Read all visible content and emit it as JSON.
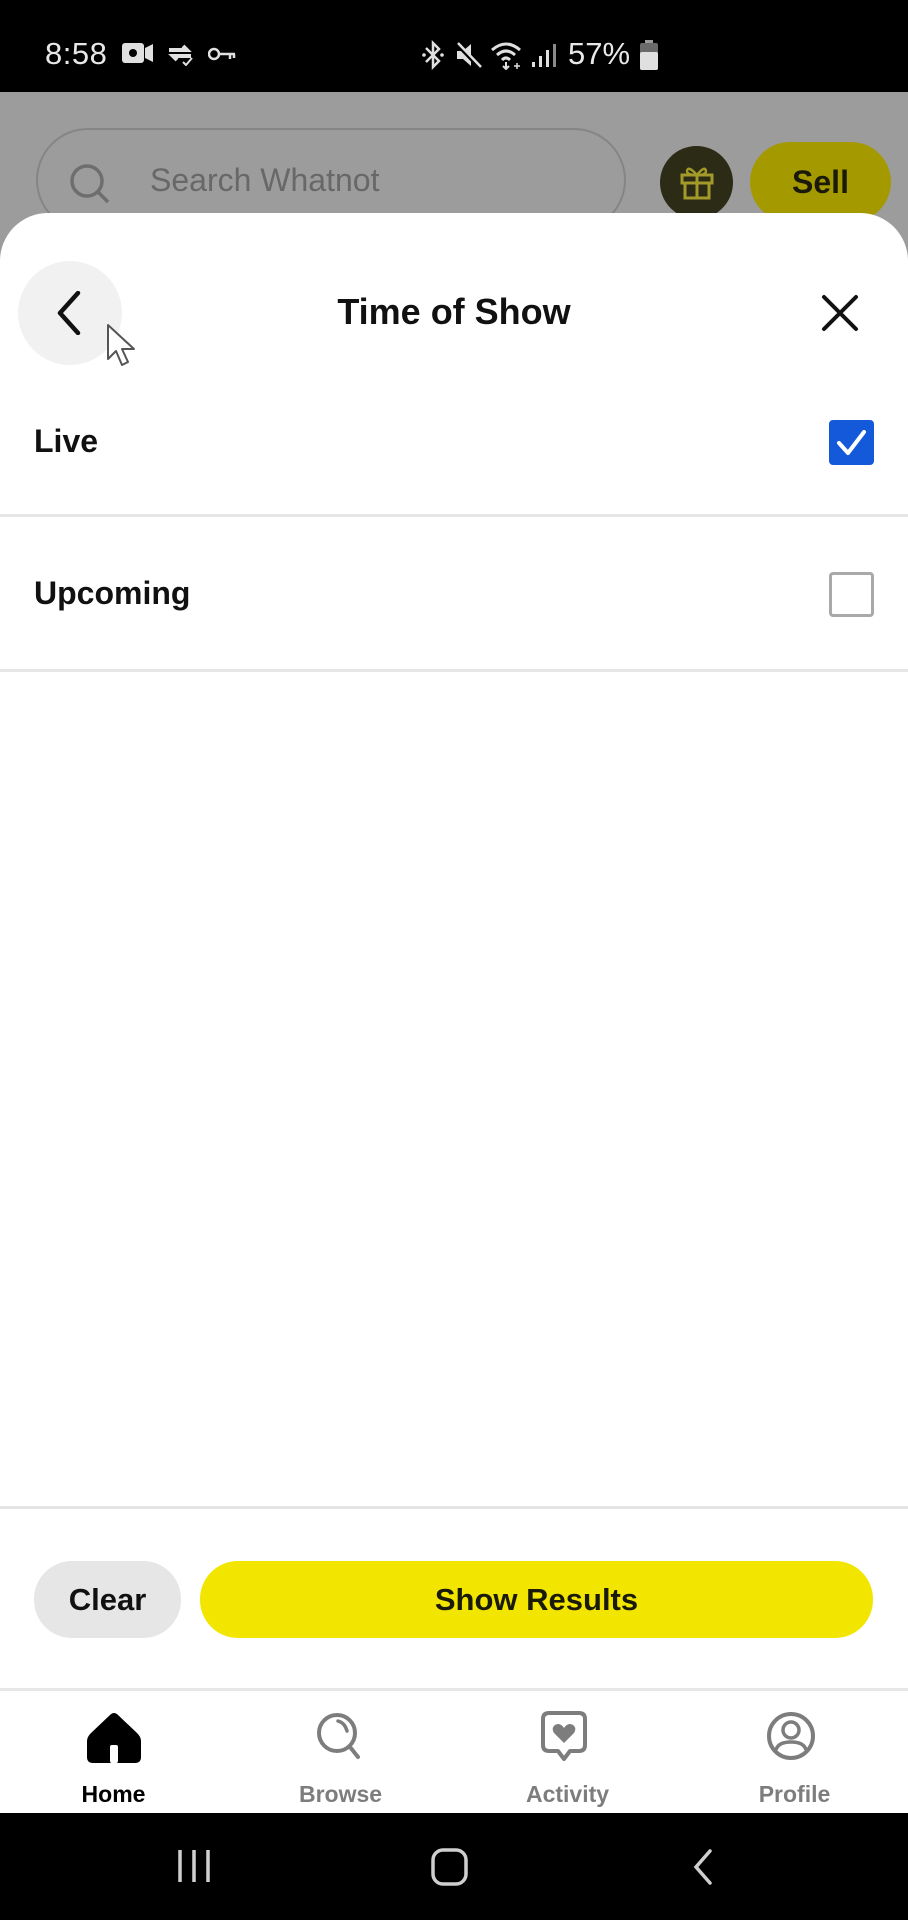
{
  "status_bar": {
    "time": "8:58",
    "battery_percent": "57%",
    "icons": [
      "video-record-icon",
      "vpn-sync-icon",
      "key-icon",
      "bluetooth-icon",
      "mute-icon",
      "wifi-icon",
      "signal-icon",
      "battery-icon"
    ]
  },
  "background_app": {
    "search_placeholder": "Search Whatnot",
    "gift_icon": "gift-icon",
    "sell_label": "Sell"
  },
  "sheet": {
    "title": "Time of Show",
    "back_icon": "chevron-left-icon",
    "close_icon": "close-icon",
    "options": [
      {
        "label": "Live",
        "checked": true
      },
      {
        "label": "Upcoming",
        "checked": false
      }
    ],
    "colors": {
      "checkbox_checked": "#1459d9",
      "primary_button": "#f2e600"
    }
  },
  "footer": {
    "clear_label": "Clear",
    "show_results_label": "Show Results"
  },
  "bottom_nav": {
    "items": [
      {
        "label": "Home",
        "icon": "home-icon",
        "active": true
      },
      {
        "label": "Browse",
        "icon": "browse-search-icon",
        "active": false
      },
      {
        "label": "Activity",
        "icon": "activity-heart-icon",
        "active": false
      },
      {
        "label": "Profile",
        "icon": "profile-icon",
        "active": false
      }
    ]
  },
  "system_nav": {
    "buttons": [
      "recents-icon",
      "home-circle-icon",
      "back-icon"
    ]
  }
}
